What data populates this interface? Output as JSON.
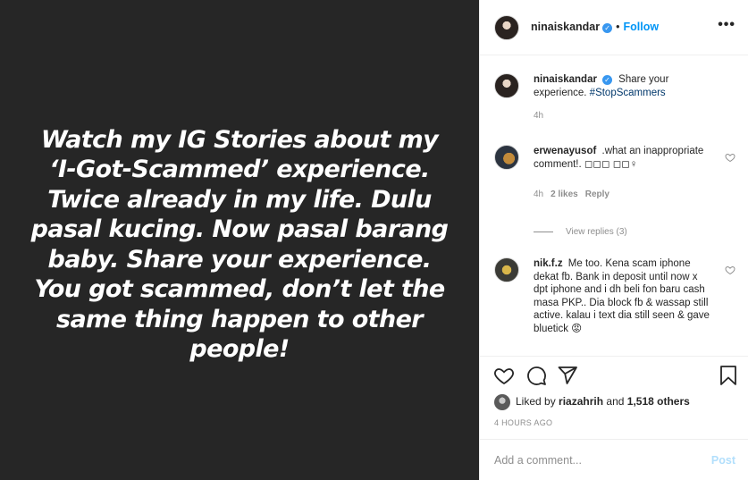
{
  "post": {
    "image_text": "Watch my IG Stories about my ‘I-Got-Scammed’ experience. Twice already in my life. Dulu pasal kucing. Now pasal barang baby. Share your experience. You got scammed, don’t let the same thing happen to other people!"
  },
  "header": {
    "username": "ninaiskandar",
    "separator": "•",
    "follow_label": "Follow",
    "more_label": "•••"
  },
  "caption": {
    "username": "ninaiskandar",
    "text": "Share your experience.",
    "hashtag": "#StopScammers",
    "time": "4h"
  },
  "comments": [
    {
      "username": "erwenayusof",
      "text": ".what an inappropriate comment!. ◻◻◻ ◻◻♀",
      "time": "4h",
      "likes": "2 likes",
      "reply_label": "Reply",
      "view_replies": "View replies (3)"
    },
    {
      "username": "nik.f.z",
      "text": "Me too. Kena scam iphone dekat fb. Bank in deposit until now x dpt iphone and i dh beli fon baru cash masa PKP.. Dia block fb & wassap still active. kalau i text dia still seen & gave bluetick 😡"
    }
  ],
  "likes": {
    "prefix": "Liked by",
    "user": "riazahrih",
    "conjunction": "and",
    "others": "1,518 others"
  },
  "timestamp": "4 HOURS AGO",
  "add_comment": {
    "placeholder": "Add a comment...",
    "post_label": "Post"
  },
  "colors": {
    "image_bg": "#262626",
    "accent": "#0095f6",
    "hashtag": "#00376b",
    "muted": "#8e8e8e"
  }
}
